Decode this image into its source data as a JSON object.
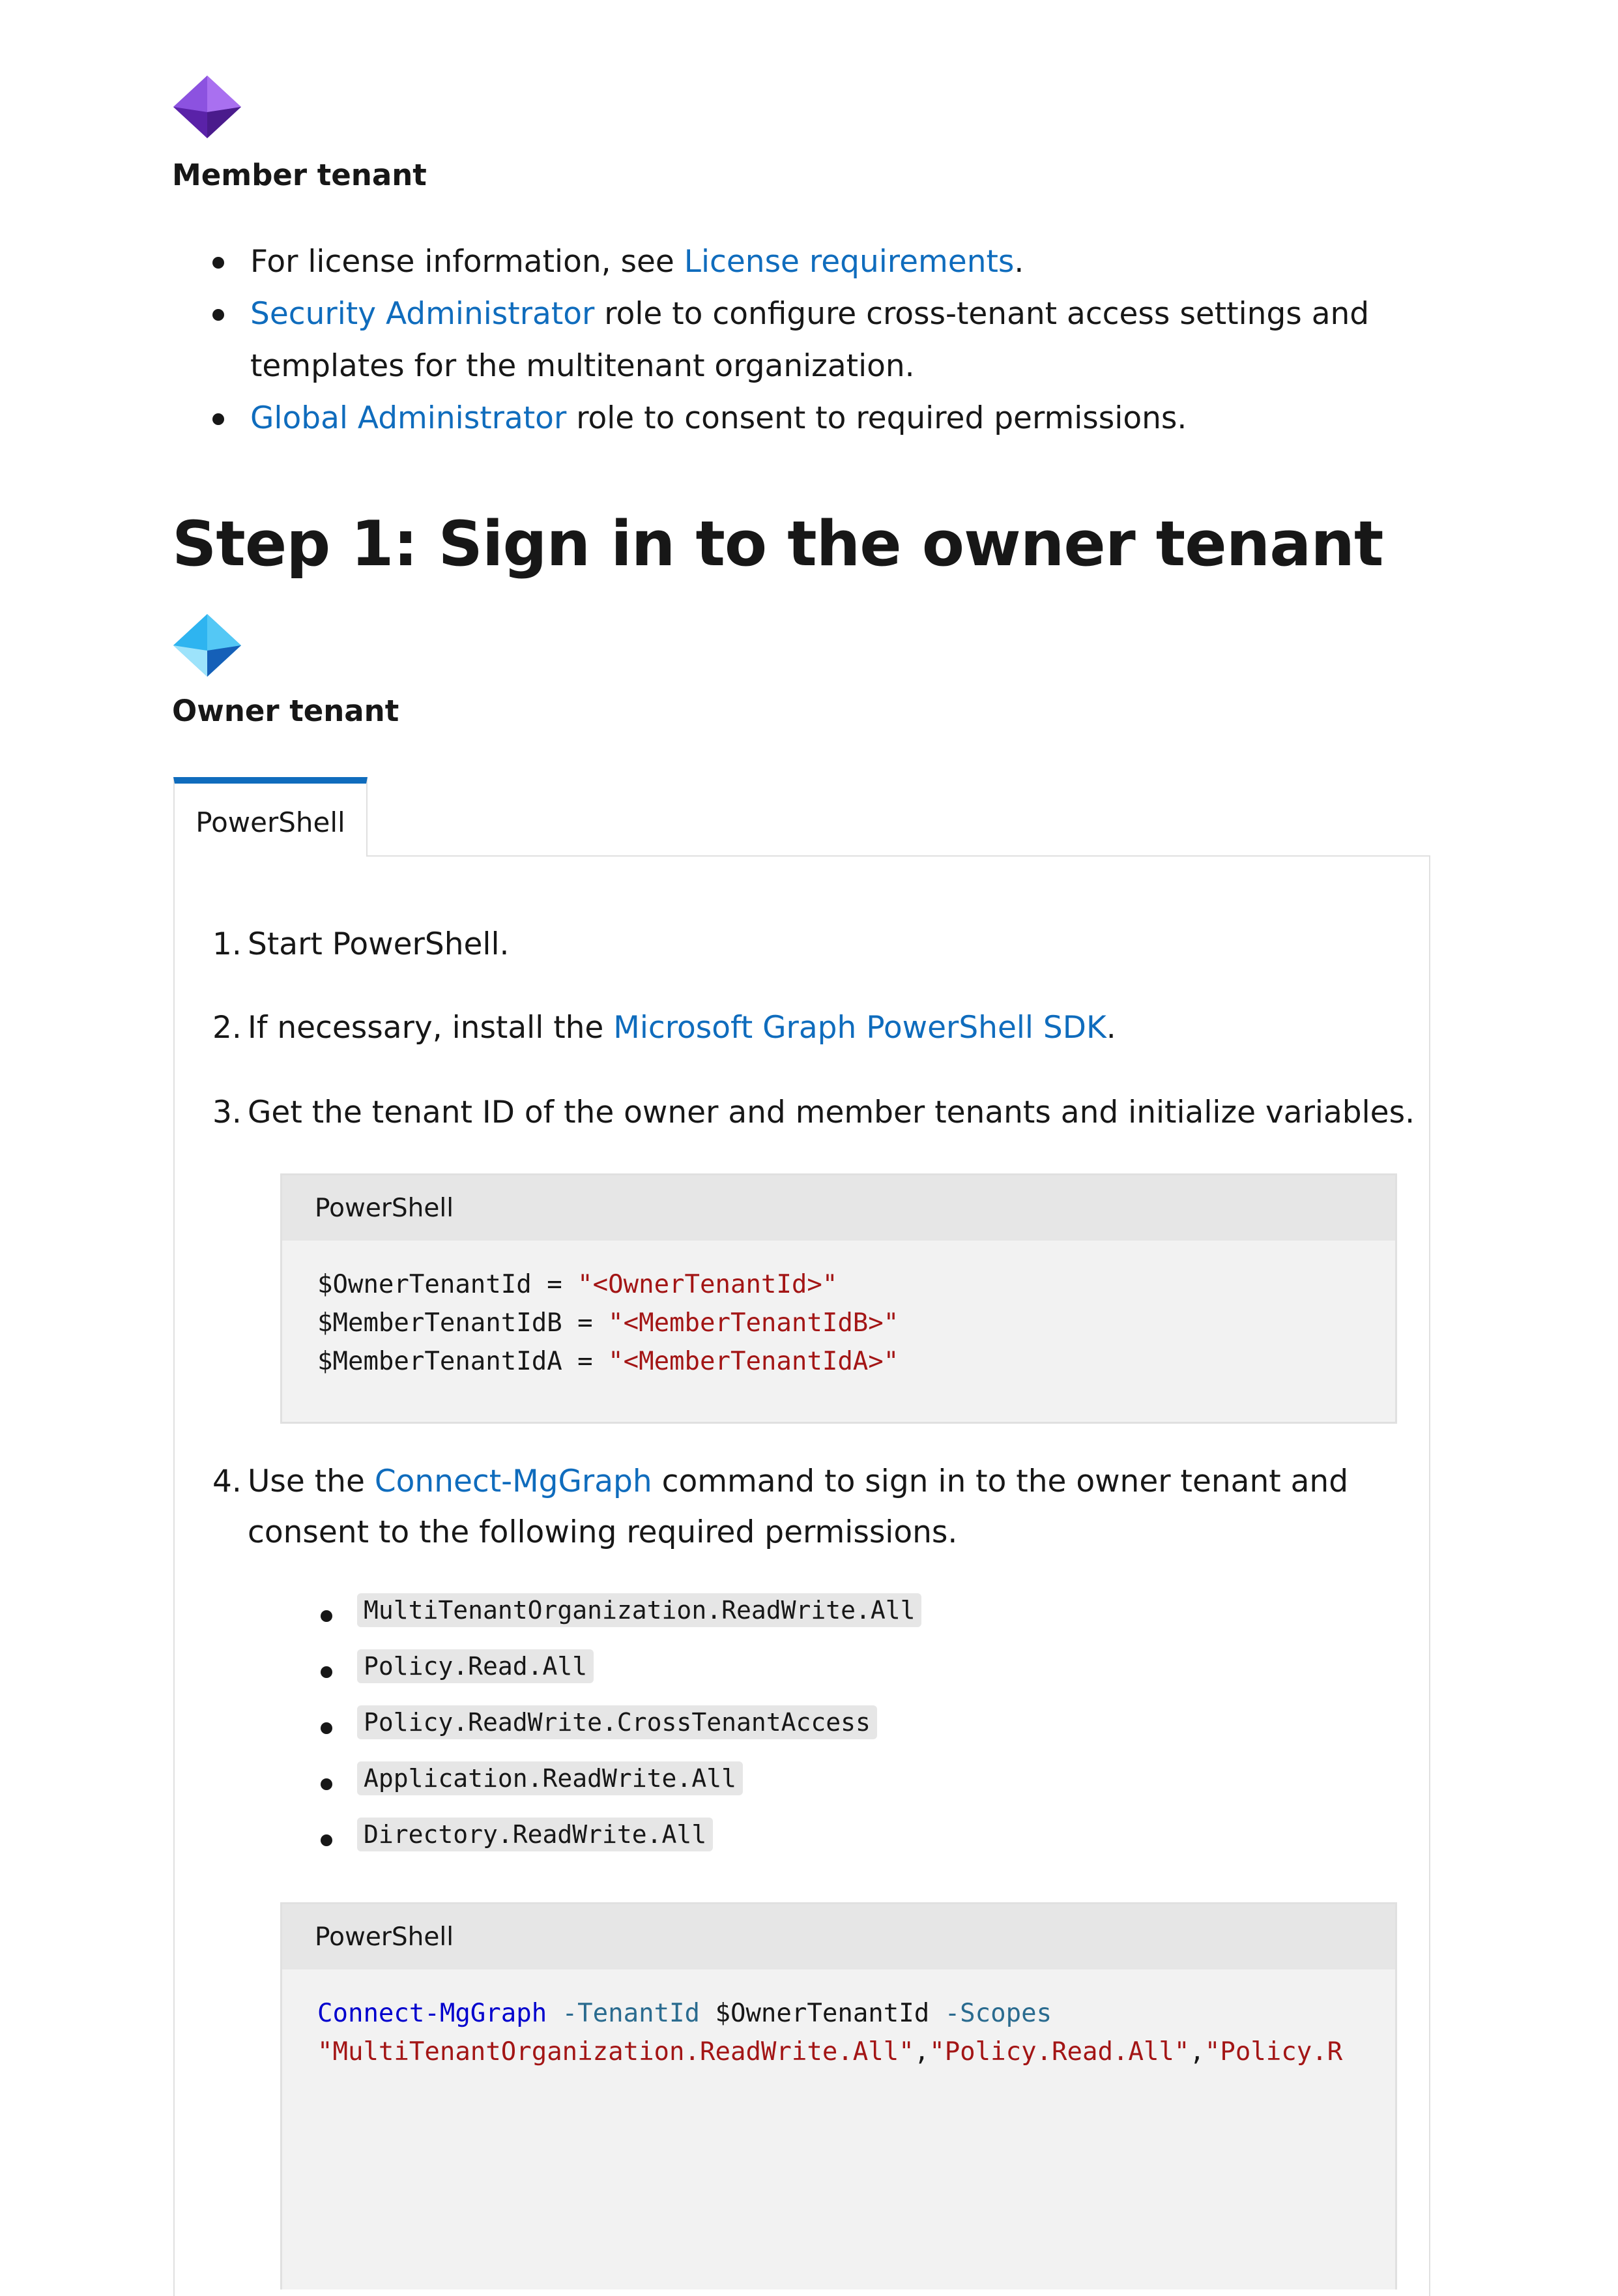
{
  "member": {
    "icon": "member-tenant-icon",
    "label": "Member tenant",
    "bullets": [
      {
        "prefix": "For license information, see ",
        "link": "License requirements",
        "suffix": "."
      },
      {
        "prefix": "",
        "link": "Security Administrator",
        "suffix": " role to configure cross-tenant access settings and templates for the multitenant organization."
      },
      {
        "prefix": "",
        "link": "Global Administrator",
        "suffix": " role to consent to required permissions."
      }
    ]
  },
  "step1": {
    "heading": "Step 1: Sign in to the owner tenant",
    "owner_icon": "owner-tenant-icon",
    "owner_label": "Owner tenant",
    "tab_label": "PowerShell",
    "items": {
      "one": {
        "num": "1.",
        "text": "Start PowerShell."
      },
      "two": {
        "num": "2.",
        "prefix": "If necessary, install the ",
        "link": "Microsoft Graph PowerShell SDK",
        "suffix": "."
      },
      "three": {
        "num": "3.",
        "text": "Get the tenant ID of the owner and member tenants and initialize variables."
      },
      "four": {
        "num": "4.",
        "prefix": "Use the ",
        "link": "Connect-MgGraph",
        "suffix": " command to sign in to the owner tenant and consent to the following required permissions."
      }
    },
    "code1": {
      "lang": "PowerShell",
      "lines": [
        {
          "var": "$OwnerTenantId = ",
          "str": "\"<OwnerTenantId>\""
        },
        {
          "var": "$MemberTenantIdB = ",
          "str": "\"<MemberTenantIdB>\""
        },
        {
          "var": "$MemberTenantIdA = ",
          "str": "\"<MemberTenantIdA>\""
        }
      ]
    },
    "permissions": [
      "MultiTenantOrganization.ReadWrite.All",
      "Policy.Read.All",
      "Policy.ReadWrite.CrossTenantAccess",
      "Application.ReadWrite.All",
      "Directory.ReadWrite.All"
    ],
    "code2": {
      "lang": "PowerShell",
      "cmd": "Connect-MgGraph",
      "p1": " -TenantId",
      "v1": " $OwnerTenantId",
      "p2": " -Scopes",
      "s1": "\"MultiTenantOrganization.ReadWrite.All\"",
      "comma1": ",",
      "s2": "\"Policy.Read.All\"",
      "comma2": ",",
      "s3": "\"Policy.R"
    }
  },
  "colors": {
    "link": "#0f6cbd",
    "string": "#a31515",
    "keyword": "#0000cd",
    "tab_accent": "#0f6cbd"
  }
}
